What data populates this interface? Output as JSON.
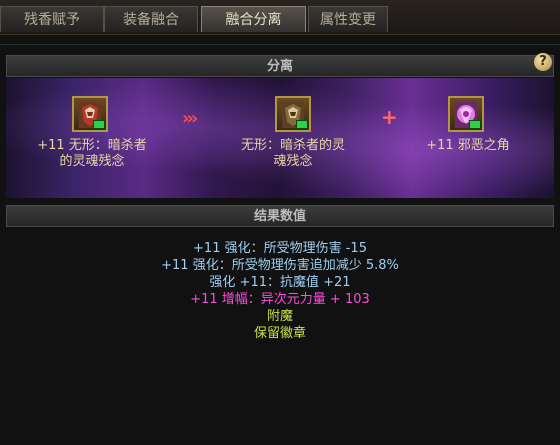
{
  "tabs": [
    {
      "label": "残香赋予"
    },
    {
      "label": "装备融合"
    },
    {
      "label": "融合分离"
    },
    {
      "label": "属性变更"
    }
  ],
  "active_tab_index": 2,
  "section_split": {
    "title": "分离"
  },
  "help": {
    "label": "?"
  },
  "items": {
    "left": {
      "name_line1": "+11 无形：暗杀者",
      "name_line2": "的灵魂残念"
    },
    "center": {
      "name_line1": "无形：暗杀者的灵",
      "name_line2": "魂残念"
    },
    "right": {
      "name_line1": "+11 邪恶之角",
      "name_line2": ""
    }
  },
  "section_result": {
    "title": "结果数值"
  },
  "results": [
    {
      "text": "+11 强化：所受物理伤害 -15",
      "style": "blue"
    },
    {
      "text": "+11 强化：所受物理伤害追加减少 5.8%",
      "style": "blue"
    },
    {
      "text": "强化 +11：抗魔值 +21",
      "style": "blue"
    },
    {
      "text": "+11 增幅：异次元力量 + 103",
      "style": "purple"
    },
    {
      "text": "附魔",
      "style": "green"
    },
    {
      "text": "保留徽章",
      "style": "green"
    }
  ],
  "colors": {
    "accent_red": "#ff4a4a",
    "result_blue": "#9ecff0",
    "result_purple": "#ff4ce0",
    "result_green": "#c6e24a"
  },
  "icons": {
    "arrows": "triple-chevron-right-icon",
    "plus": "plus-icon",
    "help": "question-mark-icon"
  }
}
